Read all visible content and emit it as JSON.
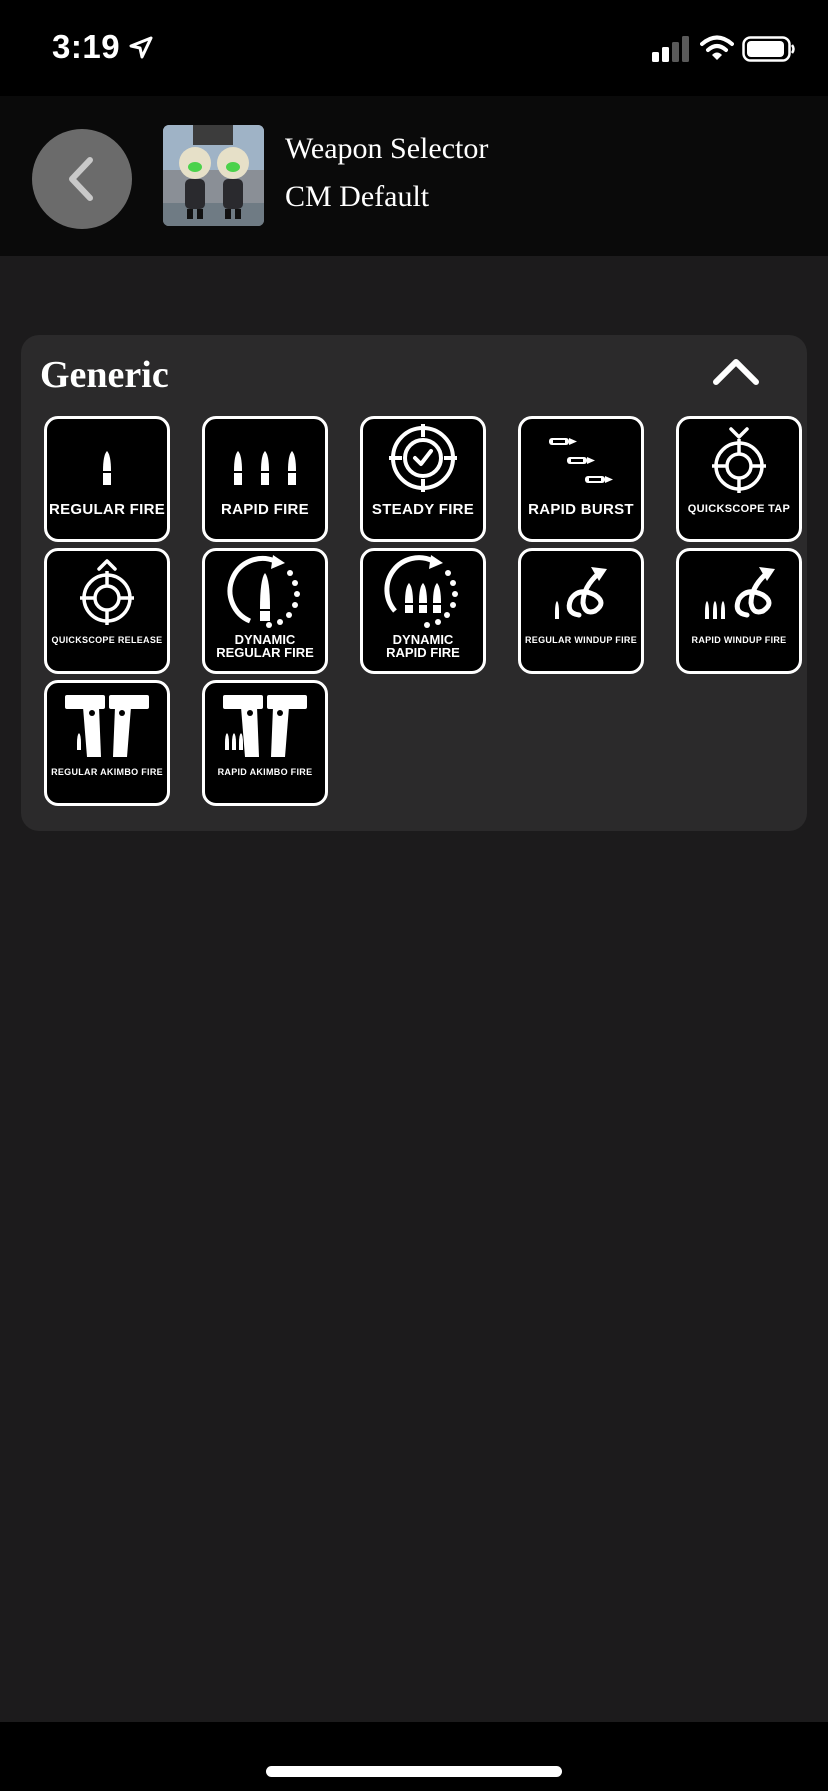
{
  "status_bar": {
    "time": "3:19",
    "icons": [
      "location-arrow-icon",
      "cellular-signal-icon",
      "wifi-icon",
      "battery-icon"
    ]
  },
  "nav": {
    "back_icon": "chevron-left-icon",
    "title": "Weapon Selector",
    "subtitle": "CM Default"
  },
  "section": {
    "title": "Generic",
    "collapse_icon": "chevron-up-icon",
    "items": [
      {
        "label": "REGULAR FIRE",
        "icon": "single-bullet-icon"
      },
      {
        "label": "RAPID FIRE",
        "icon": "triple-bullet-icon"
      },
      {
        "label": "STEADY FIRE",
        "icon": "crosshair-check-icon"
      },
      {
        "label": "RAPID BURST",
        "icon": "burst-bullets-icon"
      },
      {
        "label": "QUICKSCOPE TAP",
        "icon": "quickscope-tap-icon"
      },
      {
        "label": "QUICKSCOPE RELEASE",
        "icon": "quickscope-release-icon"
      },
      {
        "label_line1": "DYNAMIC",
        "label_line2": "REGULAR FIRE",
        "icon": "dynamic-single-bullet-icon"
      },
      {
        "label_line1": "DYNAMIC",
        "label_line2": "RAPID FIRE",
        "icon": "dynamic-triple-bullet-icon"
      },
      {
        "label": "REGULAR WINDUP FIRE",
        "icon": "windup-single-icon"
      },
      {
        "label": "RAPID WINDUP FIRE",
        "icon": "windup-triple-icon"
      },
      {
        "label": "REGULAR AKIMBO FIRE",
        "icon": "akimbo-pistols-single-icon"
      },
      {
        "label": "RAPID AKIMBO FIRE",
        "icon": "akimbo-pistols-triple-icon"
      }
    ]
  },
  "colors": {
    "background": "#1c1b1c",
    "panel": "#2b2a2b",
    "status_bar": "#000000",
    "nav_bar": "#0a0a0a",
    "back_button": "#6b6b6b",
    "tile": "#000000",
    "tile_border": "#ffffff"
  }
}
